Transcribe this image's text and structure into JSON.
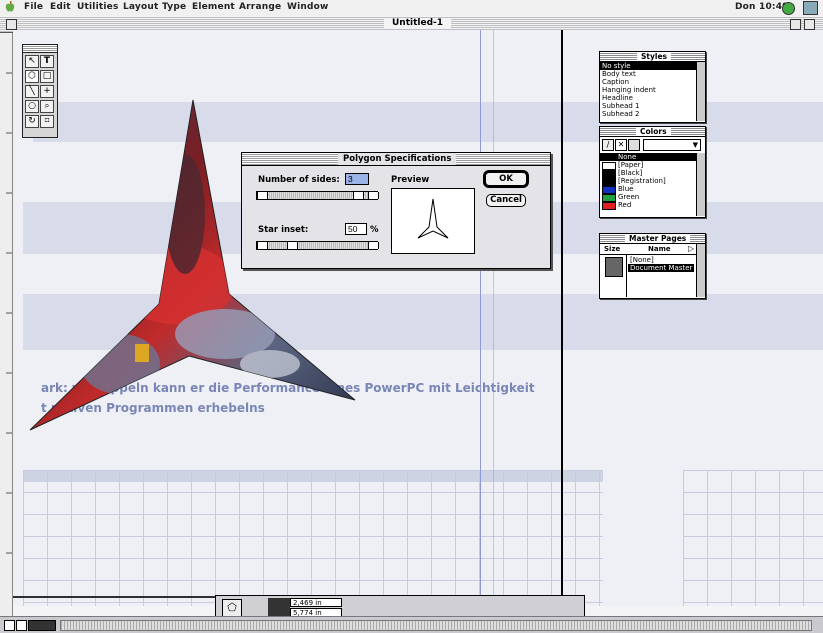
{
  "menubar": {
    "items": [
      "File",
      "Edit",
      "Utilities",
      "Layout",
      "Type",
      "Element",
      "Arrange",
      "Window"
    ],
    "clock": "Don 10:49"
  },
  "window": {
    "title": "Untitled-1"
  },
  "dialog": {
    "title": "Polygon Specifications",
    "sides_label": "Number of sides:",
    "sides_value": "3",
    "inset_label": "Star inset:",
    "inset_value": "50",
    "inset_unit": "%",
    "preview_label": "Preview",
    "ok_label": "OK",
    "cancel_label": "Cancel"
  },
  "styles_palette": {
    "title": "Styles",
    "items": [
      "No style",
      "Body text",
      "Caption",
      "Hanging indent",
      "Headline",
      "Subhead 1",
      "Subhead 2"
    ]
  },
  "colors_palette": {
    "title": "Colors",
    "items": [
      {
        "name": "None",
        "color": "#ffffff"
      },
      {
        "name": "[Paper]",
        "color": "#ffffff"
      },
      {
        "name": "[Black]",
        "color": "#000000"
      },
      {
        "name": "[Registration]",
        "color": "#000000"
      },
      {
        "name": "Blue",
        "color": "#1030c0"
      },
      {
        "name": "Green",
        "color": "#20a040"
      },
      {
        "name": "Red",
        "color": "#e02020"
      }
    ]
  },
  "master_palette": {
    "title": "Master Pages",
    "col_size": "Size",
    "col_name": "Name",
    "items": [
      "[None]",
      "Document Master"
    ]
  },
  "background_text": {
    "line1": "ark: verdoppeln kann er die Performance eines PowerPC mit Leichtigkeit",
    "line2": "t nativen Programmen erhebelns"
  },
  "statusbar": {
    "x_value": "2,469 in",
    "y_value": "5,774 in"
  }
}
